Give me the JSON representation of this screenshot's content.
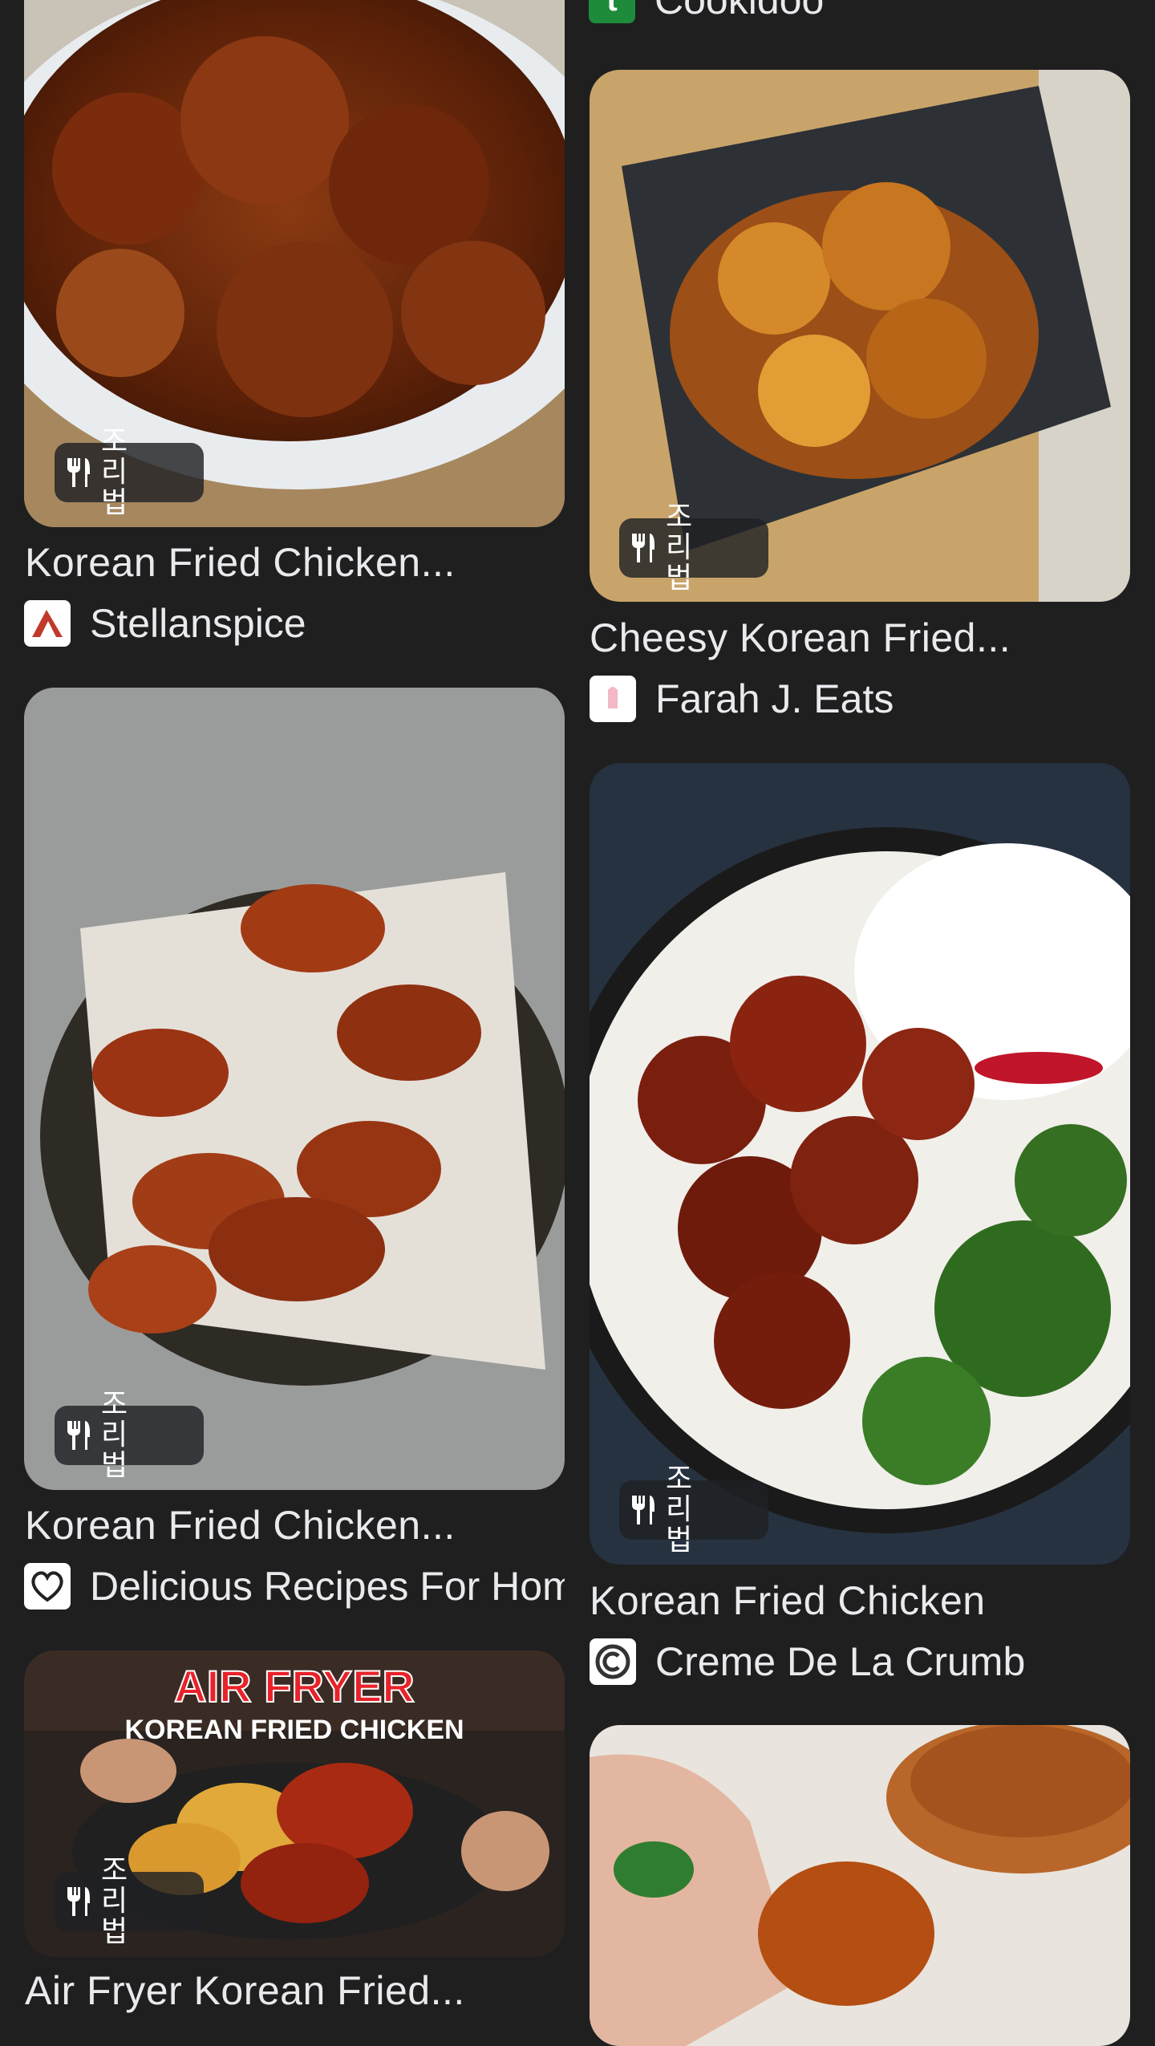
{
  "badge_label": "조리법",
  "left_column": [
    {
      "title": "Korean Fried Chicken...",
      "source": "Stellanspice",
      "favicon": "chili-logo-icon"
    },
    {
      "title": "Korean Fried Chicken...",
      "source": "Delicious Recipes For Hom",
      "favicon": "heart-logo-icon"
    },
    {
      "title": "Air Fryer Korean Fried...",
      "source": "",
      "favicon": "",
      "thumbnail_text_1": "AIR FRYER",
      "thumbnail_text_2": "KOREAN FRIED CHICKEN"
    }
  ],
  "right_column": [
    {
      "source": "Cookidoo",
      "favicon": "cookidoo-logo-icon"
    },
    {
      "title": "Cheesy Korean Fried...",
      "source": "Farah J. Eats",
      "favicon": "farah-logo-icon"
    },
    {
      "title": "Korean Fried Chicken",
      "source": "Creme De La Crumb",
      "favicon": "crumb-logo-icon"
    },
    {
      "title": "",
      "source": "",
      "favicon": ""
    }
  ],
  "colors": {
    "background": "#1f1f1f",
    "text": "#e8eaed",
    "badge": "#202124"
  }
}
